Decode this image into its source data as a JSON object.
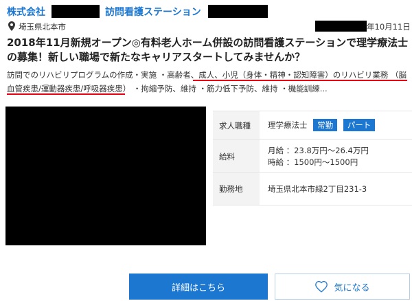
{
  "header": {
    "company_prefix": "株式会社",
    "facility_name": "訪問看護ステーション"
  },
  "listing": {
    "location": "埼玉県北本市",
    "date": "年10月11日",
    "title": "2018年11月新規オープン◎有料老人ホーム併設の訪問看護ステーションで理学療法士の募集！新しい職場で新たなキャリアスタートしてみませんか？",
    "description": "訪問でのリハビリプログラムの作成・実施 ・高齢者、成人、小児（身体・精神・認知障害）のリハビリ業務 （脳血管疾患/運動器疾患/呼吸器疾患） ・拘縮予防、維持 ・筋力低下予防、維持 ・機能訓練..."
  },
  "info": {
    "job_type_label": "求人職種",
    "job_type_value": "理学療法士",
    "badge_fulltime": "常勤",
    "badge_parttime": "パート",
    "salary_label": "給料",
    "salary_monthly": "月給 ：23.8万円～26.4万円",
    "salary_hourly": "時給 ：1500円～1500円",
    "location_label": "勤務地",
    "location_value": "埼玉県北本市緑2丁目231-3"
  },
  "buttons": {
    "detail": "詳細はこちら",
    "favorite": "気になる"
  },
  "colors": {
    "accent": "#1c77d1",
    "underline": "#e60012"
  },
  "icons": {
    "location": "map-pin-icon",
    "favorite": "heart-icon"
  }
}
